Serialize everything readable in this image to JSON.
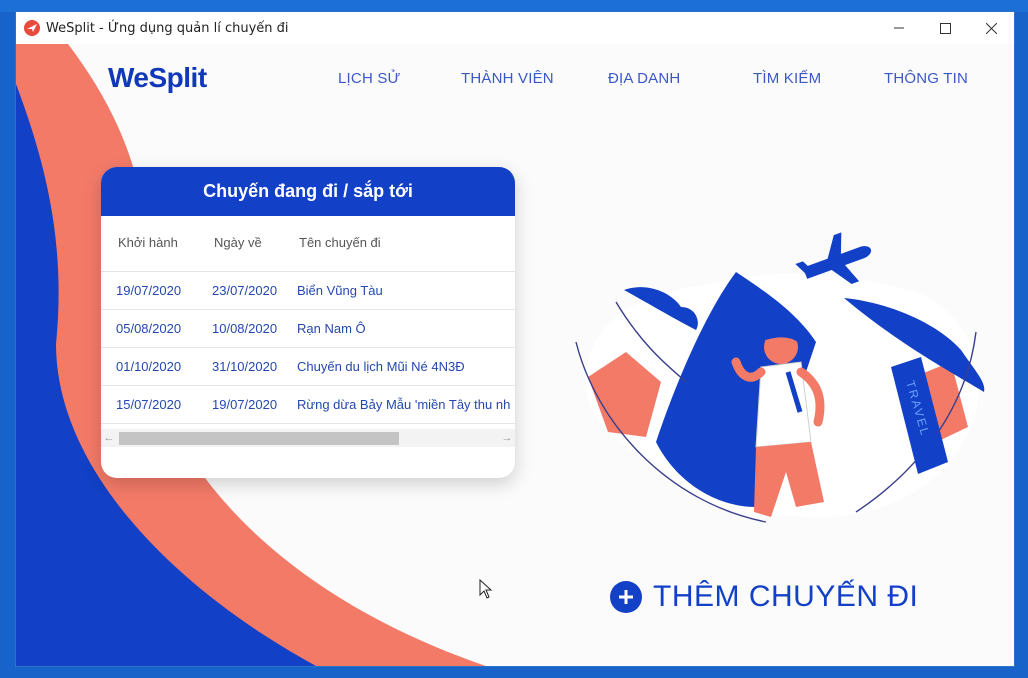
{
  "window": {
    "title": "WeSplit - Ứng dụng quản lí chuyến đi"
  },
  "app": {
    "logo": "WeSplit",
    "nav": [
      "LỊCH SỬ",
      "THÀNH VIÊN",
      "ĐỊA DANH",
      "TÌM KIẾM",
      "THÔNG TIN"
    ]
  },
  "trips_card": {
    "title": "Chuyến đang đi / sắp tới",
    "columns": [
      "Khởi hành",
      "Ngày về",
      "Tên chuyến đi"
    ],
    "rows": [
      [
        "19/07/2020",
        "23/07/2020",
        "Biển Vũng Tàu"
      ],
      [
        "05/08/2020",
        "10/08/2020",
        "Rạn Nam Ô"
      ],
      [
        "01/10/2020",
        "31/10/2020",
        "Chuyến du lịch Mũi Né 4N3Đ"
      ],
      [
        "15/07/2020",
        "19/07/2020",
        "Rừng dừa Bảy Mẫu 'miền Tây thu nh"
      ]
    ]
  },
  "illustration": {
    "badge_text": "TRAVEL"
  },
  "actions": {
    "add_trip_label": "THÊM CHUYẾN ĐI"
  },
  "colors": {
    "primary": "#1240c6",
    "accent": "#f47a68",
    "desktop": "#1763c9"
  }
}
